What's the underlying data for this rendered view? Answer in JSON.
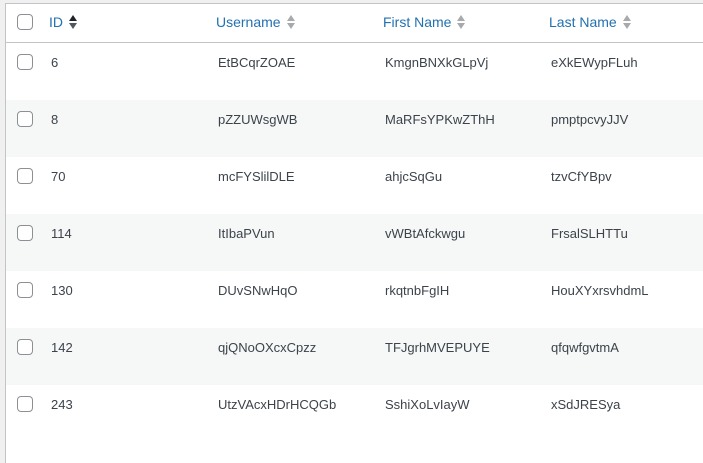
{
  "table": {
    "columns": {
      "id": "ID",
      "username": "Username",
      "first_name": "First Name",
      "last_name": "Last Name"
    },
    "sort": {
      "column": "id",
      "direction": "ascending"
    },
    "rows": [
      {
        "id": "6",
        "username": "EtBCqrZOAE",
        "first_name": "KmgnBNXkGLpVj",
        "last_name": "eXkEWypFLuh"
      },
      {
        "id": "8",
        "username": "pZZUWsgWB",
        "first_name": "MaRFsYPKwZThH",
        "last_name": "pmptpcvyJJV"
      },
      {
        "id": "70",
        "username": "mcFYSlilDLE",
        "first_name": "ahjcSqGu",
        "last_name": "tzvCfYBpv"
      },
      {
        "id": "114",
        "username": "ItIbaPVun",
        "first_name": "vWBtAfckwgu",
        "last_name": "FrsalSLHTTu"
      },
      {
        "id": "130",
        "username": "DUvSNwHqO",
        "first_name": "rkqtnbFgIH",
        "last_name": "HouXYxrsvhdmL"
      },
      {
        "id": "142",
        "username": "qjQNoOXcxCpzz",
        "first_name": "TFJgrhMVEPUYE",
        "last_name": "qfqwfgvtmA"
      },
      {
        "id": "243",
        "username": "UtzVAcxHDrHCQGb",
        "first_name": "SshiXoLvIayW",
        "last_name": "xSdJRESya"
      }
    ]
  }
}
